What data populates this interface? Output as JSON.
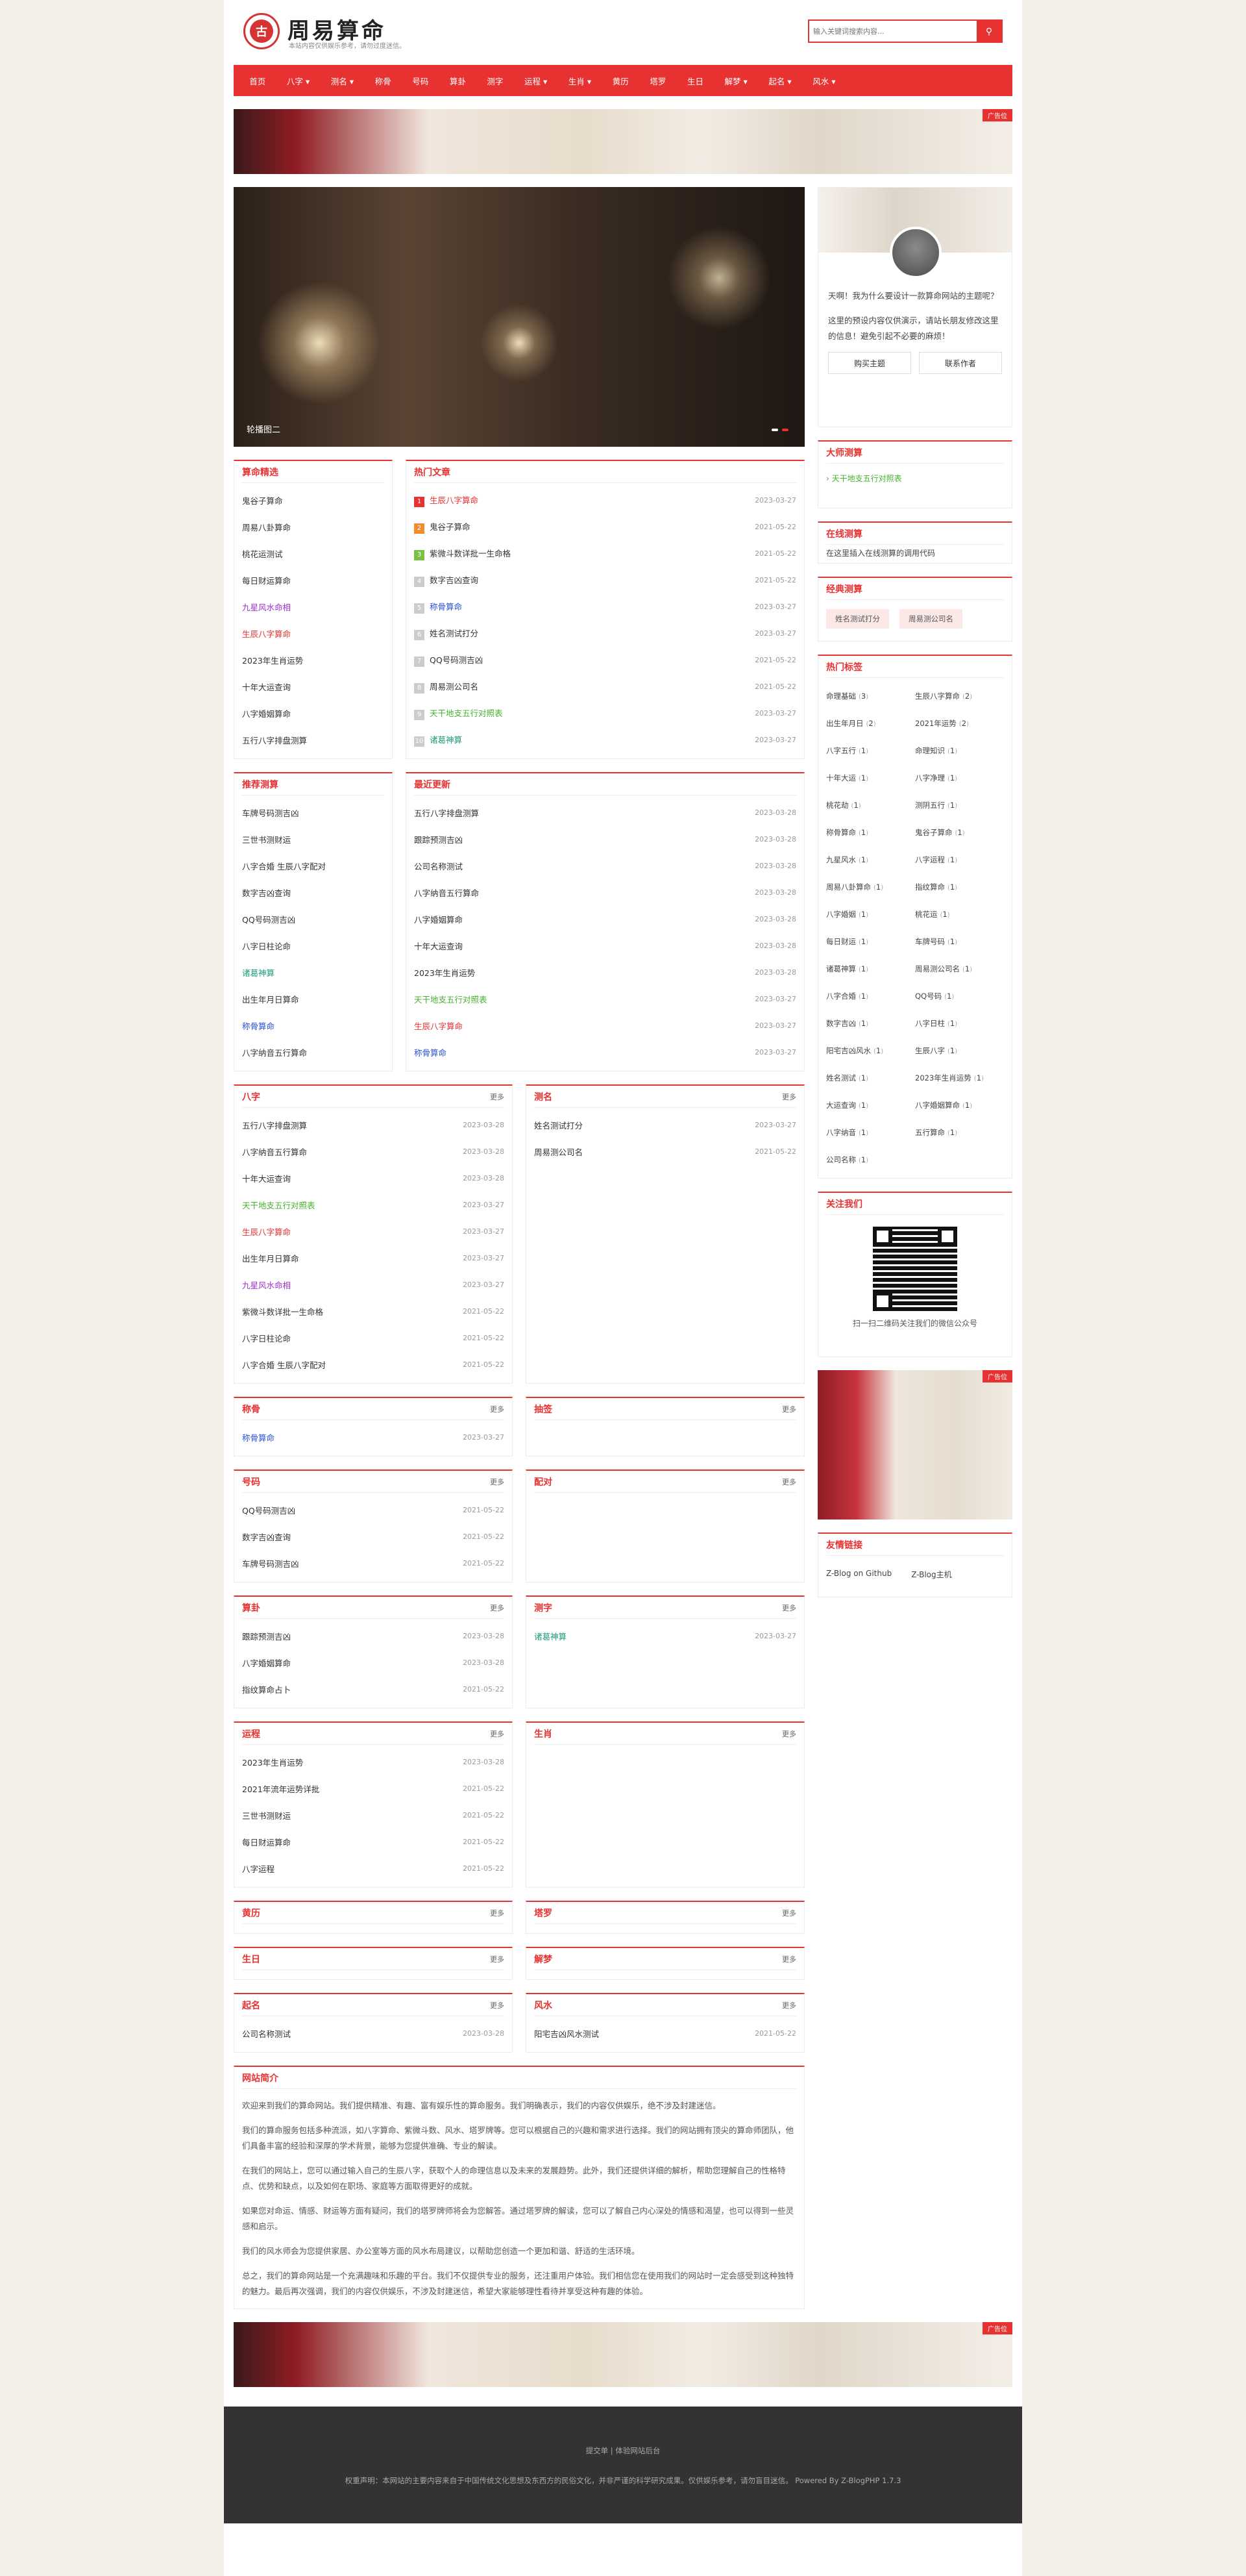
{
  "site": {
    "title": "周易算命",
    "subtitle": "本站内容仅供娱乐参考，请勿过度迷信。",
    "seal": "古"
  },
  "search": {
    "placeholder": "输入关键词搜索内容..."
  },
  "nav": [
    "首页",
    "八字 ▾",
    "测名 ▾",
    "称骨",
    "号码",
    "算卦",
    "测字",
    "运程 ▾",
    "生肖 ▾",
    "黄历",
    "塔罗",
    "生日",
    "解梦 ▾",
    "起名 ▾",
    "风水 ▾"
  ],
  "ad": {
    "label": "广告位"
  },
  "slider": {
    "caption": "轮播图二"
  },
  "boxes": {
    "jingxuan": {
      "title": "算命精选",
      "items": [
        {
          "t": "鬼谷子算命",
          "c": ""
        },
        {
          "t": "周易八卦算命",
          "c": ""
        },
        {
          "t": "桃花运测试",
          "c": ""
        },
        {
          "t": "每日财运算命",
          "c": ""
        },
        {
          "t": "九星风水命相",
          "c": "c-pur"
        },
        {
          "t": "生辰八字算命",
          "c": "c-red"
        },
        {
          "t": "2023年生肖运势",
          "c": ""
        },
        {
          "t": "十年大运查询",
          "c": ""
        },
        {
          "t": "八字婚姻算命",
          "c": ""
        },
        {
          "t": "五行八字排盘测算",
          "c": ""
        }
      ]
    },
    "hot": {
      "title": "热门文章",
      "items": [
        {
          "t": "生辰八字算命",
          "d": "2023-03-27",
          "c": "c-red"
        },
        {
          "t": "鬼谷子算命",
          "d": "2021-05-22",
          "c": ""
        },
        {
          "t": "紫微斗数详批一生命格",
          "d": "2021-05-22",
          "c": ""
        },
        {
          "t": "数字吉凶查询",
          "d": "2021-05-22",
          "c": ""
        },
        {
          "t": "称骨算命",
          "d": "2023-03-27",
          "c": "c-blu"
        },
        {
          "t": "姓名测试打分",
          "d": "2023-03-27",
          "c": ""
        },
        {
          "t": "QQ号码测吉凶",
          "d": "2021-05-22",
          "c": ""
        },
        {
          "t": "周易测公司名",
          "d": "2021-05-22",
          "c": ""
        },
        {
          "t": "天干地支五行对照表",
          "d": "2023-03-27",
          "c": "c-lgrn"
        },
        {
          "t": "诸葛神算",
          "d": "2023-03-27",
          "c": "c-teal"
        }
      ]
    },
    "tuijian": {
      "title": "推荐测算",
      "items": [
        {
          "t": "车牌号码测吉凶",
          "c": ""
        },
        {
          "t": "三世书测财运",
          "c": ""
        },
        {
          "t": "八字合婚 生辰八字配对",
          "c": ""
        },
        {
          "t": "数字吉凶查询",
          "c": ""
        },
        {
          "t": "QQ号码测吉凶",
          "c": ""
        },
        {
          "t": "八字日柱论命",
          "c": ""
        },
        {
          "t": "诸葛神算",
          "c": "c-teal"
        },
        {
          "t": "出生年月日算命",
          "c": ""
        },
        {
          "t": "称骨算命",
          "c": "c-blu"
        },
        {
          "t": "八字纳音五行算命",
          "c": ""
        }
      ]
    },
    "newest": {
      "title": "最近更新",
      "items": [
        {
          "t": "五行八字排盘测算",
          "d": "2023-03-28",
          "c": ""
        },
        {
          "t": "跟踪预测吉凶",
          "d": "2023-03-28",
          "c": ""
        },
        {
          "t": "公司名称测试",
          "d": "2023-03-28",
          "c": ""
        },
        {
          "t": "八字纳音五行算命",
          "d": "2023-03-28",
          "c": ""
        },
        {
          "t": "八字婚姻算命",
          "d": "2023-03-28",
          "c": ""
        },
        {
          "t": "十年大运查询",
          "d": "2023-03-28",
          "c": ""
        },
        {
          "t": "2023年生肖运势",
          "d": "2023-03-28",
          "c": ""
        },
        {
          "t": "天干地支五行对照表",
          "d": "2023-03-27",
          "c": "c-lgrn"
        },
        {
          "t": "生辰八字算命",
          "d": "2023-03-27",
          "c": "c-red"
        },
        {
          "t": "称骨算命",
          "d": "2023-03-27",
          "c": "c-blu"
        }
      ]
    }
  },
  "more_label": "更多",
  "cats": [
    [
      {
        "title": "八字",
        "items": [
          {
            "t": "五行八字排盘测算",
            "d": "2023-03-28",
            "c": ""
          },
          {
            "t": "八字纳音五行算命",
            "d": "2023-03-28",
            "c": ""
          },
          {
            "t": "十年大运查询",
            "d": "2023-03-28",
            "c": ""
          },
          {
            "t": "天干地支五行对照表",
            "d": "2023-03-27",
            "c": "c-lgrn"
          },
          {
            "t": "生辰八字算命",
            "d": "2023-03-27",
            "c": "c-red"
          },
          {
            "t": "出生年月日算命",
            "d": "2023-03-27",
            "c": ""
          },
          {
            "t": "九星风水命相",
            "d": "2023-03-27",
            "c": "c-pur"
          },
          {
            "t": "紫微斗数详批一生命格",
            "d": "2021-05-22",
            "c": ""
          },
          {
            "t": "八字日柱论命",
            "d": "2021-05-22",
            "c": ""
          },
          {
            "t": "八字合婚 生辰八字配对",
            "d": "2021-05-22",
            "c": ""
          }
        ]
      },
      {
        "title": "测名",
        "items": [
          {
            "t": "姓名测试打分",
            "d": "2023-03-27",
            "c": ""
          },
          {
            "t": "周易测公司名",
            "d": "2021-05-22",
            "c": ""
          }
        ]
      }
    ],
    [
      {
        "title": "称骨",
        "items": [
          {
            "t": "称骨算命",
            "d": "2023-03-27",
            "c": "c-blu"
          }
        ]
      },
      {
        "title": "抽签",
        "items": []
      }
    ],
    [
      {
        "title": "号码",
        "items": [
          {
            "t": "QQ号码测吉凶",
            "d": "2021-05-22",
            "c": ""
          },
          {
            "t": "数字吉凶查询",
            "d": "2021-05-22",
            "c": ""
          },
          {
            "t": "车牌号码测吉凶",
            "d": "2021-05-22",
            "c": ""
          }
        ]
      },
      {
        "title": "配对",
        "items": []
      }
    ],
    [
      {
        "title": "算卦",
        "items": [
          {
            "t": "跟踪预测吉凶",
            "d": "2023-03-28",
            "c": ""
          },
          {
            "t": "八字婚姻算命",
            "d": "2023-03-28",
            "c": ""
          },
          {
            "t": "指纹算命占卜",
            "d": "2021-05-22",
            "c": ""
          }
        ]
      },
      {
        "title": "测字",
        "items": [
          {
            "t": "诸葛神算",
            "d": "2023-03-27",
            "c": "c-teal"
          }
        ]
      }
    ],
    [
      {
        "title": "运程",
        "items": [
          {
            "t": "2023年生肖运势",
            "d": "2023-03-28",
            "c": ""
          },
          {
            "t": "2021年流年运势详批",
            "d": "2021-05-22",
            "c": ""
          },
          {
            "t": "三世书测财运",
            "d": "2021-05-22",
            "c": ""
          },
          {
            "t": "每日财运算命",
            "d": "2021-05-22",
            "c": ""
          },
          {
            "t": "八字运程",
            "d": "2021-05-22",
            "c": ""
          }
        ]
      },
      {
        "title": "生肖",
        "items": []
      }
    ],
    [
      {
        "title": "黄历",
        "items": []
      },
      {
        "title": "塔罗",
        "items": []
      }
    ],
    [
      {
        "title": "生日",
        "items": []
      },
      {
        "title": "解梦",
        "items": []
      }
    ],
    [
      {
        "title": "起名",
        "items": [
          {
            "t": "公司名称测试",
            "d": "2023-03-28",
            "c": ""
          }
        ]
      },
      {
        "title": "风水",
        "items": [
          {
            "t": "阳宅吉凶风水测试",
            "d": "2021-05-22",
            "c": ""
          }
        ]
      }
    ]
  ],
  "intro": {
    "title": "网站简介",
    "paras": [
      "欢迎来到我们的算命网站。我们提供精准、有趣、富有娱乐性的算命服务。我们明确表示，我们的内容仅供娱乐，绝不涉及封建迷信。",
      "我们的算命服务包括多种流派，如八字算命、紫微斗数、风水、塔罗牌等。您可以根据自己的兴趣和需求进行选择。我们的网站拥有顶尖的算命师团队，他们具备丰富的经验和深厚的学术背景，能够为您提供准确、专业的解读。",
      "在我们的网站上，您可以通过输入自己的生辰八字，获取个人的命理信息以及未来的发展趋势。此外，我们还提供详细的解析，帮助您理解自己的性格特点、优势和缺点，以及如何在职场、家庭等方面取得更好的成就。",
      "如果您对命运、情感、财运等方面有疑问，我们的塔罗牌师将会为您解答。通过塔罗牌的解读，您可以了解自己内心深处的情感和渴望，也可以得到一些灵感和启示。",
      "我们的风水师会为您提供家居、办公室等方面的风水布局建议，以帮助您创造一个更加和谐、舒适的生活环境。",
      "总之，我们的算命网站是一个充满趣味和乐趣的平台。我们不仅提供专业的服务，还注重用户体验。我们相信您在使用我们的网站时一定会感受到这种独特的魅力。最后再次强调，我们的内容仅供娱乐，不涉及封建迷信，希望大家能够理性看待并享受这种有趣的体验。"
    ]
  },
  "profile": {
    "text1": "天啊！我为什么要设计一款算命网站的主题呢？",
    "text2": "这里的预设内容仅供演示，请站长朋友修改这里的信息！避免引起不必要的麻烦！",
    "btn_buy": "购买主题",
    "btn_contact": "联系作者"
  },
  "side": {
    "dashi": {
      "title": "大师测算",
      "item": "天干地支五行对照表"
    },
    "online": {
      "title": "在线测算",
      "item": "在这里插入在线测算的调用代码"
    },
    "classic": {
      "title": "经典测算",
      "items": [
        "姓名测试打分",
        "周易测公司名"
      ]
    },
    "tags": {
      "title": "热门标签",
      "items": [
        [
          "命理基础",
          "3"
        ],
        [
          "生辰八字算命",
          "2"
        ],
        [
          "出生年月日",
          "2"
        ],
        [
          "2021年运势",
          "2"
        ],
        [
          "八字五行",
          "1"
        ],
        [
          "命理知识",
          "1"
        ],
        [
          "十年大运",
          "1"
        ],
        [
          "八字净理",
          "1"
        ],
        [
          "桃花劫",
          "1"
        ],
        [
          "测阴五行",
          "1"
        ],
        [
          "称骨算命",
          "1"
        ],
        [
          "鬼谷子算命",
          "1"
        ],
        [
          "九星风水",
          "1"
        ],
        [
          "八字运程",
          "1"
        ],
        [
          "周易八卦算命",
          "1"
        ],
        [
          "指纹算命",
          "1"
        ],
        [
          "八字婚姻",
          "1"
        ],
        [
          "桃花运",
          "1"
        ],
        [
          "每日财运",
          "1"
        ],
        [
          "车牌号码",
          "1"
        ],
        [
          "诸葛神算",
          "1"
        ],
        [
          "周易测公司名",
          "1"
        ],
        [
          "八字合婚",
          "1"
        ],
        [
          "QQ号码",
          "1"
        ],
        [
          "数字吉凶",
          "1"
        ],
        [
          "八字日柱",
          "1"
        ],
        [
          "阳宅吉凶风水",
          "1"
        ],
        [
          "生辰八字",
          "1"
        ],
        [
          "姓名测试",
          "1"
        ],
        [
          "2023年生肖运势",
          "1"
        ],
        [
          "大运查询",
          "1"
        ],
        [
          "八字婚姻算命",
          "1"
        ],
        [
          "八字纳音",
          "1"
        ],
        [
          "五行算命",
          "1"
        ],
        [
          "公司名称",
          "1"
        ]
      ]
    },
    "follow": {
      "title": "关注我们",
      "caption": "扫一扫二维码关注我们的微信公众号"
    },
    "links": {
      "title": "友情链接",
      "items": [
        "Z-Blog on Github",
        "Z-Blog主机"
      ]
    }
  },
  "footer": {
    "links": "提交单   |   体验网站后台",
    "copy": "权重声明：本网站的主要内容来自于中国传统文化思想及东西方的民俗文化，并非严谨的科学研究成果。仅供娱乐参考，请勿盲目迷信。  Powered By Z-BlogPHP 1.7.3"
  }
}
